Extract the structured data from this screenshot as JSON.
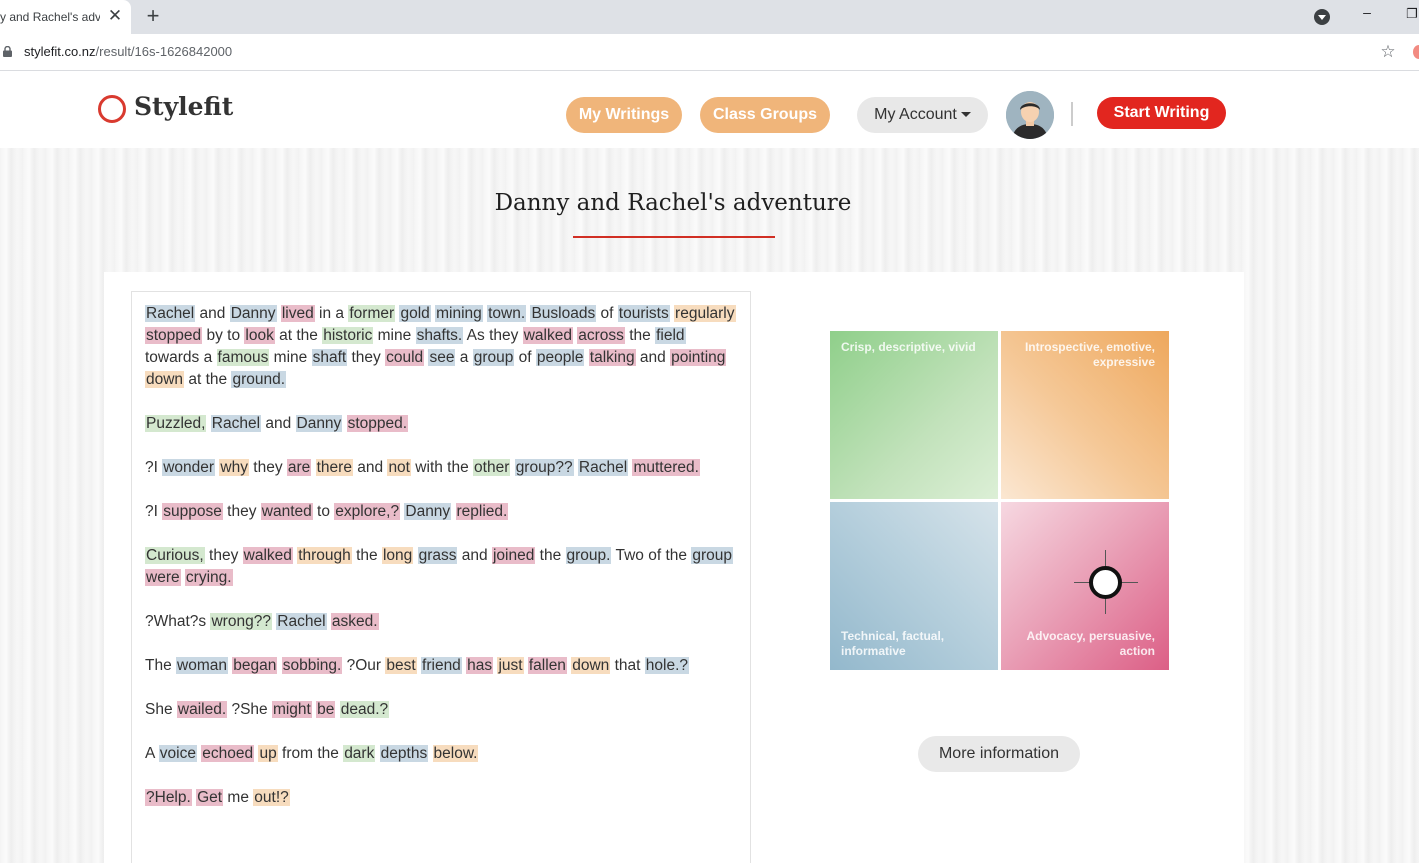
{
  "browser": {
    "tab_title": "y and Rachel's adve",
    "tab_close": "✕",
    "new_tab": "+",
    "minimize": "–",
    "maximize": "❐",
    "url_host": "stylefit.co.nz",
    "url_path": "/result/16s-1626842000",
    "bookmark_star": "☆"
  },
  "site": {
    "logo_text": "Stylefit",
    "nav": {
      "my_writings": "My Writings",
      "class_groups": "Class Groups",
      "my_account": "My Account",
      "start_writing": "Start Writing"
    },
    "accent_color": "#e2261f",
    "pill_color": "#f0b57a"
  },
  "page": {
    "title": "Danny and Rachel's adventure",
    "more_info": "More information"
  },
  "paragraphs": [
    [
      [
        "Rachel",
        "b"
      ],
      [
        " and "
      ],
      [
        "Danny",
        "b"
      ],
      [
        " "
      ],
      [
        "lived",
        "r"
      ],
      [
        " in a "
      ],
      [
        "former",
        "g"
      ],
      [
        " "
      ],
      [
        "gold",
        "b"
      ],
      [
        " "
      ],
      [
        "mining",
        "b"
      ],
      [
        " "
      ],
      [
        "town.",
        "b"
      ],
      [
        " "
      ],
      [
        "Busloads",
        "b"
      ],
      [
        " of "
      ],
      [
        "tourists",
        "b"
      ],
      [
        " "
      ],
      [
        "regularly",
        "o"
      ],
      [
        " "
      ],
      [
        "stopped",
        "r"
      ],
      [
        " by to "
      ],
      [
        "look",
        "r"
      ],
      [
        " at the "
      ],
      [
        "historic",
        "g"
      ],
      [
        " mine "
      ],
      [
        "shafts.",
        "b"
      ],
      [
        " As they "
      ],
      [
        "walked",
        "r"
      ],
      [
        " "
      ],
      [
        "across",
        "r"
      ],
      [
        " the "
      ],
      [
        "field",
        "b"
      ],
      [
        " towards a "
      ],
      [
        "famous",
        "g"
      ],
      [
        " mine "
      ],
      [
        "shaft",
        "b"
      ],
      [
        " they "
      ],
      [
        "could",
        "r"
      ],
      [
        " "
      ],
      [
        "see",
        "b"
      ],
      [
        " a "
      ],
      [
        "group",
        "b"
      ],
      [
        " of "
      ],
      [
        "people",
        "b"
      ],
      [
        " "
      ],
      [
        "talking",
        "r"
      ],
      [
        " and "
      ],
      [
        "pointing",
        "r"
      ],
      [
        " "
      ],
      [
        "down",
        "o"
      ],
      [
        " at the "
      ],
      [
        "ground.",
        "b"
      ]
    ],
    [
      [
        "Puzzled,",
        "g"
      ],
      [
        " "
      ],
      [
        "Rachel",
        "b"
      ],
      [
        " and "
      ],
      [
        "Danny",
        "b"
      ],
      [
        " "
      ],
      [
        "stopped.",
        "r"
      ]
    ],
    [
      [
        "?I "
      ],
      [
        "wonder",
        "b"
      ],
      [
        " "
      ],
      [
        "why",
        "o"
      ],
      [
        " they "
      ],
      [
        "are",
        "r"
      ],
      [
        " "
      ],
      [
        "there",
        "o"
      ],
      [
        " and "
      ],
      [
        "not",
        "o"
      ],
      [
        " with the "
      ],
      [
        "other",
        "g"
      ],
      [
        " "
      ],
      [
        "group??",
        "b"
      ],
      [
        " "
      ],
      [
        "Rachel",
        "b"
      ],
      [
        " "
      ],
      [
        "muttered.",
        "r"
      ]
    ],
    [
      [
        "?I "
      ],
      [
        "suppose",
        "r"
      ],
      [
        " they "
      ],
      [
        "wanted",
        "r"
      ],
      [
        " to "
      ],
      [
        "explore,?",
        "r"
      ],
      [
        " "
      ],
      [
        "Danny",
        "b"
      ],
      [
        " "
      ],
      [
        "replied.",
        "r"
      ]
    ],
    [
      [
        "Curious,",
        "g"
      ],
      [
        " they "
      ],
      [
        "walked",
        "r"
      ],
      [
        " "
      ],
      [
        "through",
        "o"
      ],
      [
        " the "
      ],
      [
        "long",
        "o"
      ],
      [
        " "
      ],
      [
        "grass",
        "b"
      ],
      [
        " and "
      ],
      [
        "joined",
        "r"
      ],
      [
        " the "
      ],
      [
        "group.",
        "b"
      ],
      [
        " Two of the "
      ],
      [
        "group",
        "b"
      ],
      [
        " "
      ],
      [
        "were",
        "r"
      ],
      [
        " "
      ],
      [
        "crying.",
        "r"
      ]
    ],
    [
      [
        "?What?s "
      ],
      [
        "wrong??",
        "g"
      ],
      [
        " "
      ],
      [
        "Rachel",
        "b"
      ],
      [
        " "
      ],
      [
        "asked.",
        "r"
      ]
    ],
    [
      [
        "The "
      ],
      [
        "woman",
        "b"
      ],
      [
        " "
      ],
      [
        "began",
        "r"
      ],
      [
        " "
      ],
      [
        "sobbing.",
        "r"
      ],
      [
        " ?Our "
      ],
      [
        "best",
        "o"
      ],
      [
        " "
      ],
      [
        "friend",
        "b"
      ],
      [
        " "
      ],
      [
        "has",
        "r"
      ],
      [
        " "
      ],
      [
        "just",
        "o"
      ],
      [
        " "
      ],
      [
        "fallen",
        "r"
      ],
      [
        " "
      ],
      [
        "down",
        "o"
      ],
      [
        " that "
      ],
      [
        "hole.?",
        "b"
      ]
    ],
    [
      [
        "She "
      ],
      [
        "wailed.",
        "r"
      ],
      [
        " ?She "
      ],
      [
        "might",
        "r"
      ],
      [
        " "
      ],
      [
        "be",
        "r"
      ],
      [
        " "
      ],
      [
        "dead.?",
        "g"
      ]
    ],
    [
      [
        "A "
      ],
      [
        "voice",
        "b"
      ],
      [
        " "
      ],
      [
        "echoed",
        "r"
      ],
      [
        " "
      ],
      [
        "up",
        "o"
      ],
      [
        " from the "
      ],
      [
        "dark",
        "g"
      ],
      [
        " "
      ],
      [
        "depths",
        "b"
      ],
      [
        " "
      ],
      [
        "below.",
        "o"
      ]
    ],
    [
      [
        "?Help.",
        "r"
      ],
      [
        " "
      ],
      [
        "Get",
        "r"
      ],
      [
        " me "
      ],
      [
        "out!?",
        "o"
      ]
    ]
  ],
  "quadrant": {
    "top_left": "Crisp, descriptive, vivid",
    "top_right": "Introspective, emotive, expressive",
    "bottom_left": "Technical, factual, informative",
    "bottom_right": "Advocacy, persuasive, action"
  }
}
